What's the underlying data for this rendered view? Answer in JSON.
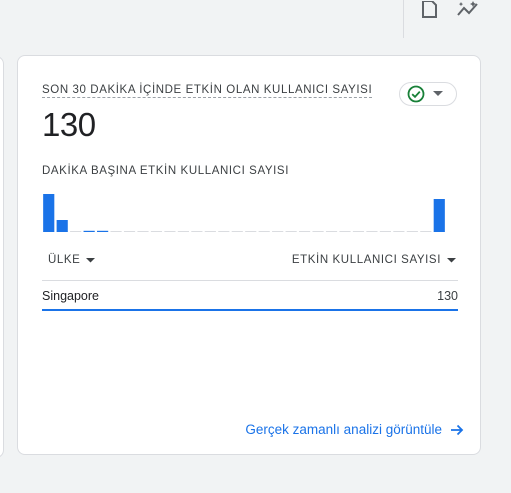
{
  "card": {
    "title": "SON 30 DAKİKA İÇİNDE ETKİN OLAN KULLANICI SAYISI",
    "value": "130",
    "subtitle": "DAKİKA BAŞINA ETKİN KULLANICI SAYISI",
    "status_icon": "check-circle-icon",
    "colors": {
      "accent": "#1a73e8",
      "status_green": "#188038"
    }
  },
  "chart_data": {
    "type": "bar",
    "title": "",
    "values": [
      38,
      12,
      0,
      1,
      1,
      0,
      0,
      0,
      0,
      0,
      0,
      0,
      0,
      0,
      0,
      0,
      0,
      0,
      0,
      0,
      0,
      0,
      0,
      0,
      0,
      0,
      0,
      0,
      0,
      33
    ],
    "ylim": [
      0,
      40
    ]
  },
  "table": {
    "columns": [
      "ÜLKE",
      "ETKİN KULLANICI SAYISI"
    ],
    "rows": [
      {
        "country": "Singapore",
        "value": "130"
      }
    ]
  },
  "footer": {
    "link_label": "Gerçek zamanlı analizi görüntüle"
  }
}
